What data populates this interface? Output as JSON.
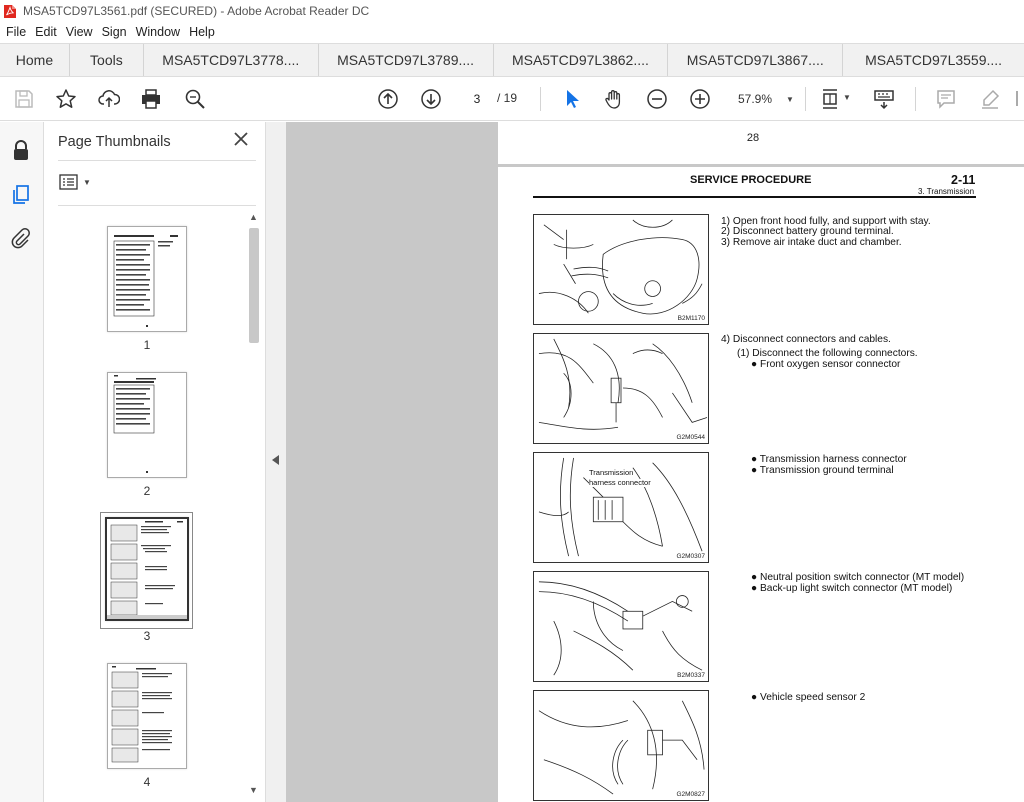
{
  "window": {
    "title": "MSA5TCD97L3561.pdf (SECURED) - Adobe Acrobat Reader DC"
  },
  "menu": [
    "File",
    "Edit",
    "View",
    "Sign",
    "Window",
    "Help"
  ],
  "tabs": {
    "home": "Home",
    "tools": "Tools",
    "documents": [
      "MSA5TCD97L3778....",
      "MSA5TCD97L3789....",
      "MSA5TCD97L3862....",
      "MSA5TCD97L3867....",
      "MSA5TCD97L3559...."
    ]
  },
  "toolbar": {
    "current_page": "3",
    "total_pages": "/ 19",
    "zoom": "57.9%"
  },
  "sidebar": {
    "title": "Page Thumbnails",
    "pages": [
      "1",
      "2",
      "3",
      "4"
    ]
  },
  "document": {
    "prev_page_number": "28",
    "header_left": "SERVICE PROCEDURE",
    "header_right": "2-11",
    "header_sub": "3. Transmission",
    "steps": {
      "s1": "1)  Open front hood fully, and support with stay.",
      "s2": "2)  Disconnect battery ground terminal.",
      "s3": "3)  Remove air intake duct and chamber.",
      "s4": "4)  Disconnect connectors and cables.",
      "s4a": "(1)  Disconnect the following connectors.",
      "b1": "●  Front oxygen sensor connector",
      "b2": "●  Transmission harness connector",
      "b3": "●  Transmission ground terminal",
      "b4": "●  Neutral position switch connector (MT model)",
      "b5": "●  Back-up light switch connector (MT model)",
      "b6": "●  Vehicle speed sensor 2"
    },
    "figures": {
      "f1_code": "B2M1170",
      "f2_code": "G2M0544",
      "f3_code": "G2M0307",
      "f3_label1": "Transmission",
      "f3_label2": "harness connector",
      "f4_code": "B2M0337",
      "f5_code": "G2M0827"
    }
  }
}
